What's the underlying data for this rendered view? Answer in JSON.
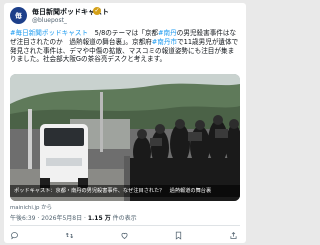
{
  "account": {
    "display_name": "毎日新聞ポッドキャスト",
    "handle": "@bluepost_",
    "avatar_initials": "毎",
    "verified_color": "#d4a017"
  },
  "tweet": {
    "hashtag1": "#毎日新聞ポッドキャスト",
    "text1": "　5/8のテーマは「京都",
    "hashtag2": "#南丹",
    "text2": "の男児殺害事件はなぜ注目されたのか　過熱報道の舞台裏」。京都府",
    "hashtag3": "#南丹市",
    "text3": "で11歳男児が遺体で発見された事件は、デマや中傷の拡散、マスコミの報道姿勢にも注目が集まりました。社会部大阪Gの茶谷亮デスクと考えます。"
  },
  "media": {
    "caption": "ポッドキャスト：京都・南丹の男児殺害事件、なぜ注目された？　過熱報道の舞台裏",
    "source": "mainichi.jp から"
  },
  "meta": {
    "time": "午後6:39 · 2026年5月8日 · ",
    "views": "1.15 万",
    "views_label": " 件の表示"
  },
  "actions": {
    "reply_count": "",
    "retweet_count": "",
    "like_count": "",
    "bookmark_count": "",
    "share_count": ""
  },
  "colors": {
    "link": "#1d9bf0",
    "text": "#0f1419",
    "muted": "#536471"
  }
}
